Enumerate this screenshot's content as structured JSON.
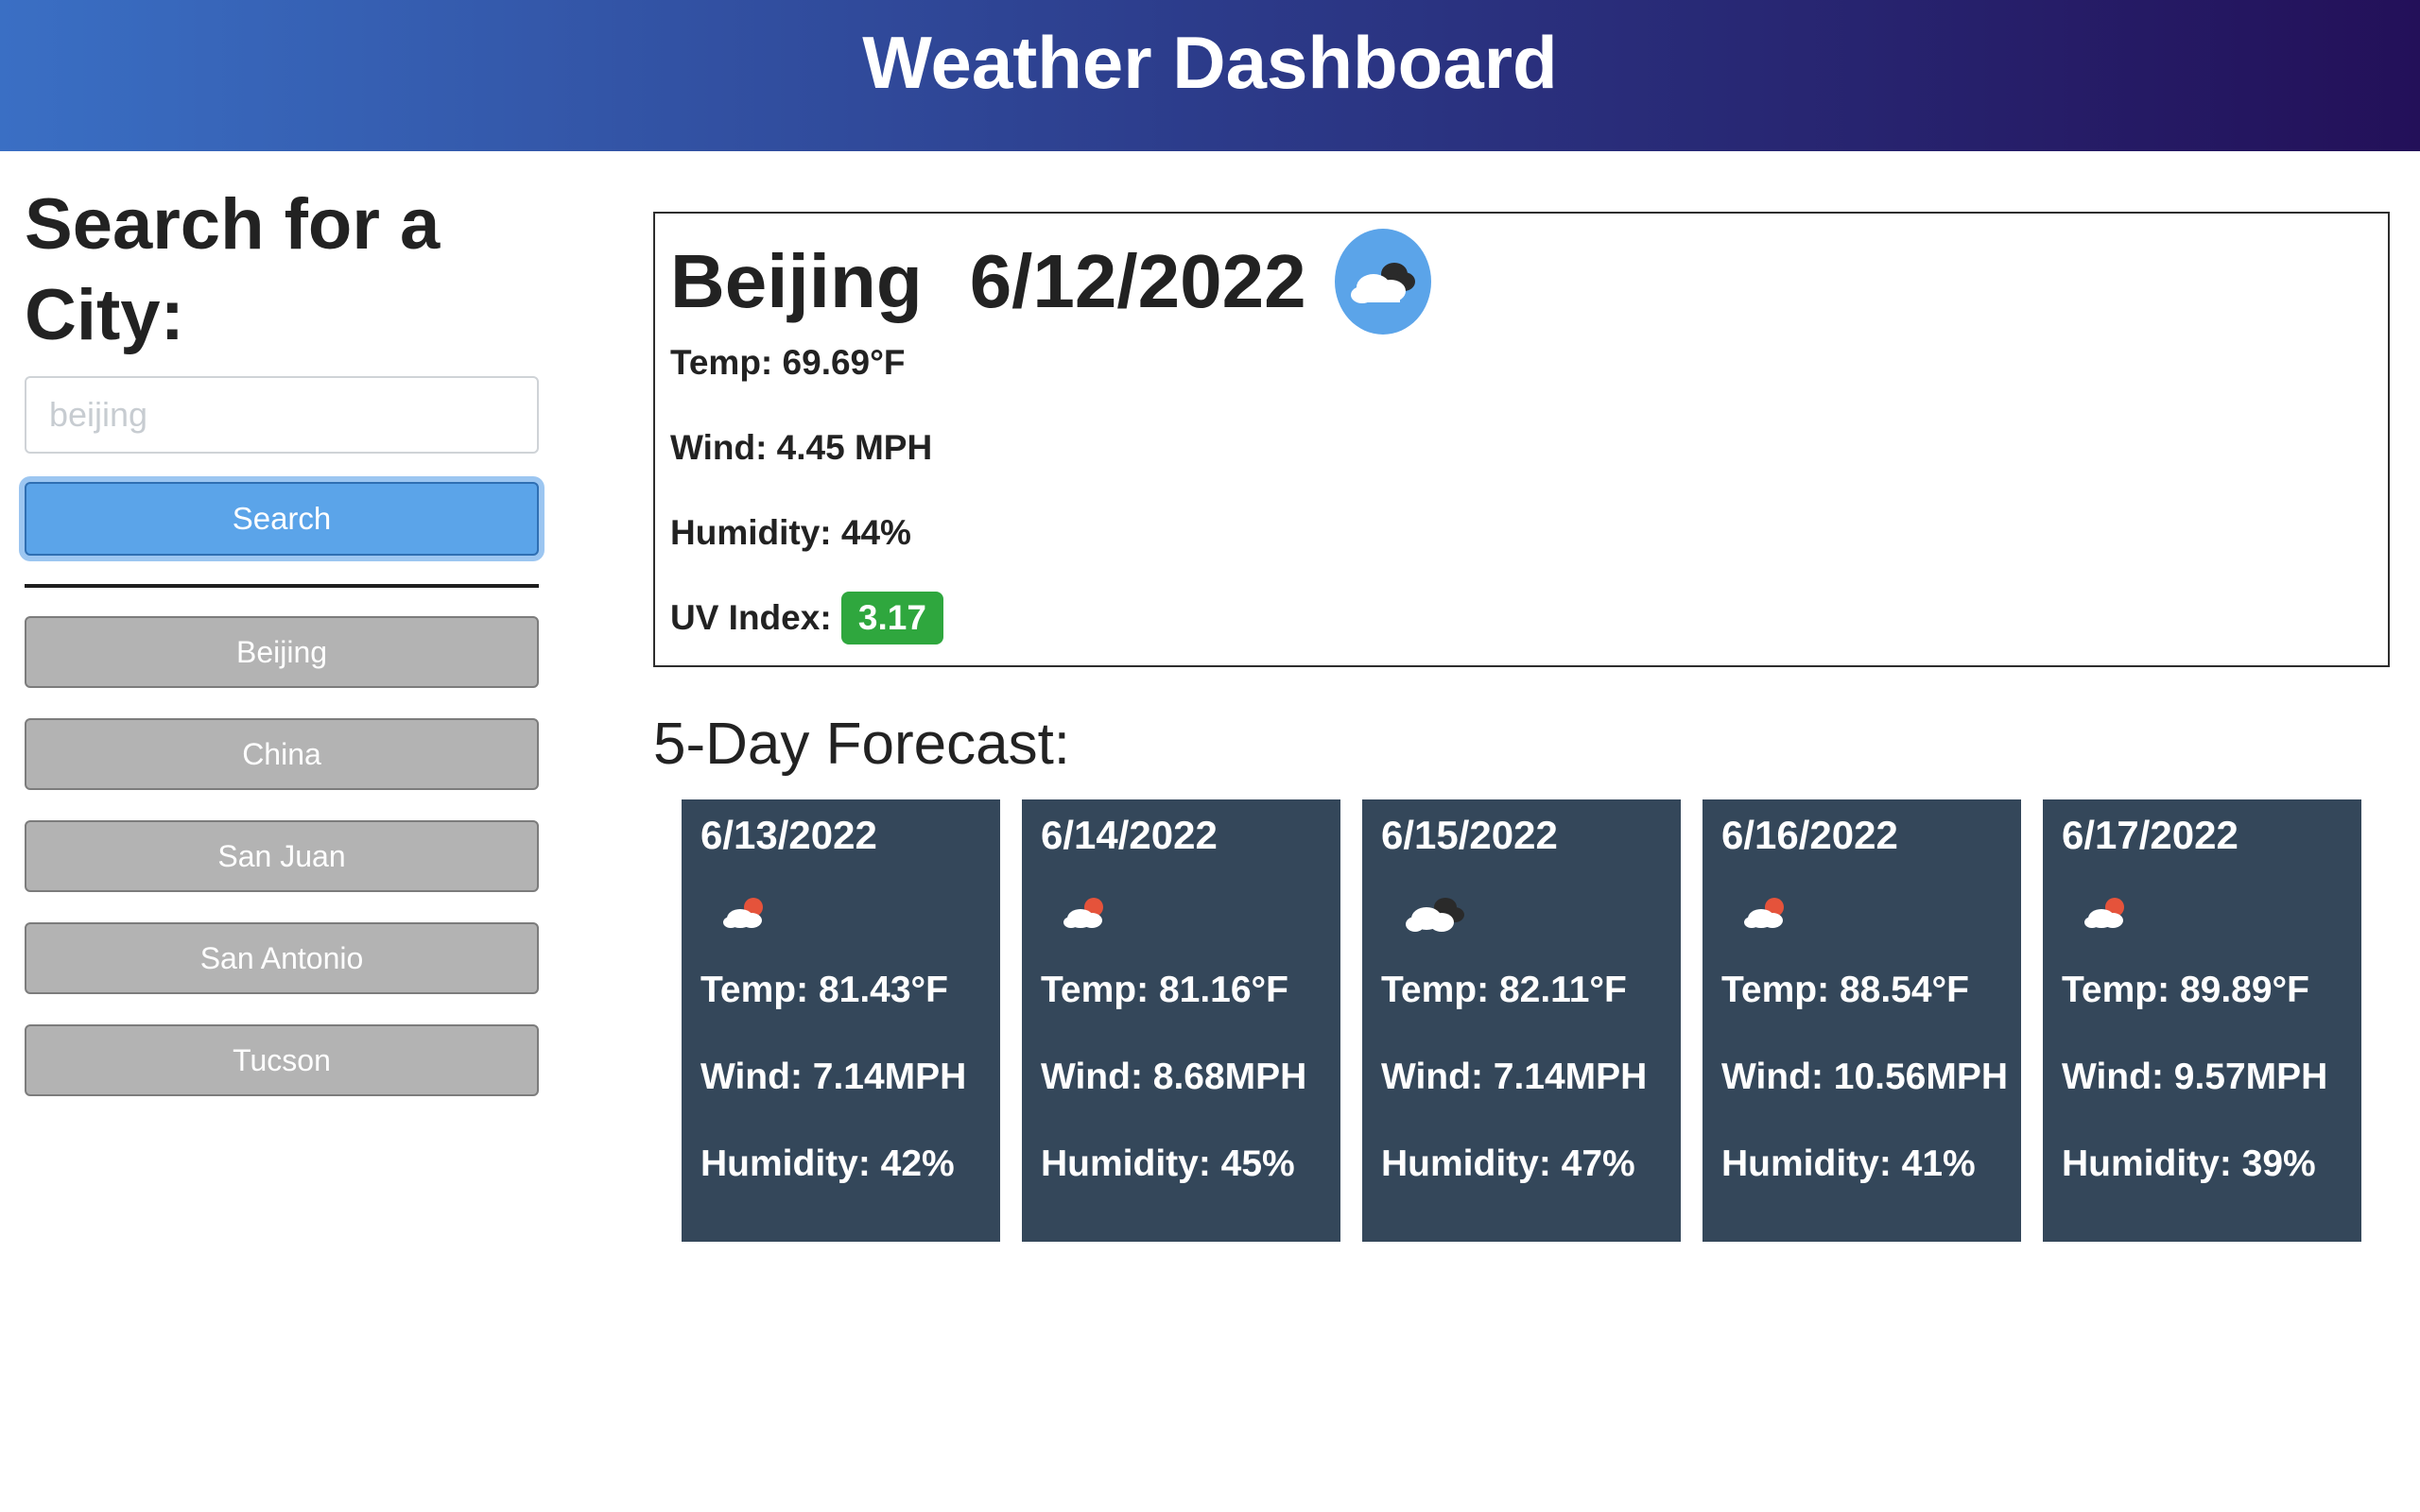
{
  "header": {
    "title": "Weather Dashboard"
  },
  "sidebar": {
    "heading": "Search for a City:",
    "search_placeholder": "beijing",
    "search_label": "Search",
    "history": [
      "Beijing",
      "China",
      "San Juan",
      "San Antonio",
      "Tucson"
    ]
  },
  "current": {
    "city": "Beijing",
    "date": "6/12/2022",
    "icon": "cloudy-icon",
    "temp": "Temp: 69.69°F",
    "wind": "Wind: 4.45 MPH",
    "humidity": "Humidity: 44%",
    "uv_label": "UV Index:",
    "uv_value": "3.17",
    "uv_color": "#2fa73e"
  },
  "forecast": {
    "title": "5-Day Forecast:",
    "days": [
      {
        "date": "6/13/2022",
        "icon": "partly-cloudy-icon",
        "temp": "Temp: 81.43°F",
        "wind": "Wind: 7.14MPH",
        "humidity": "Humidity: 42%"
      },
      {
        "date": "6/14/2022",
        "icon": "partly-cloudy-icon",
        "temp": "Temp: 81.16°F",
        "wind": "Wind: 8.68MPH",
        "humidity": "Humidity: 45%"
      },
      {
        "date": "6/15/2022",
        "icon": "cloudy-icon",
        "temp": "Temp: 82.11°F",
        "wind": "Wind: 7.14MPH",
        "humidity": "Humidity: 47%"
      },
      {
        "date": "6/16/2022",
        "icon": "partly-cloudy-icon",
        "temp": "Temp: 88.54°F",
        "wind": "Wind: 10.56MPH",
        "humidity": "Humidity: 41%"
      },
      {
        "date": "6/17/2022",
        "icon": "partly-cloudy-icon",
        "temp": "Temp: 89.89°F",
        "wind": "Wind: 9.57MPH",
        "humidity": "Humidity: 39%"
      }
    ]
  },
  "colors": {
    "accent": "#5ba4e9",
    "card_bg": "#34475a",
    "history_bg": "#b3b3b3"
  }
}
